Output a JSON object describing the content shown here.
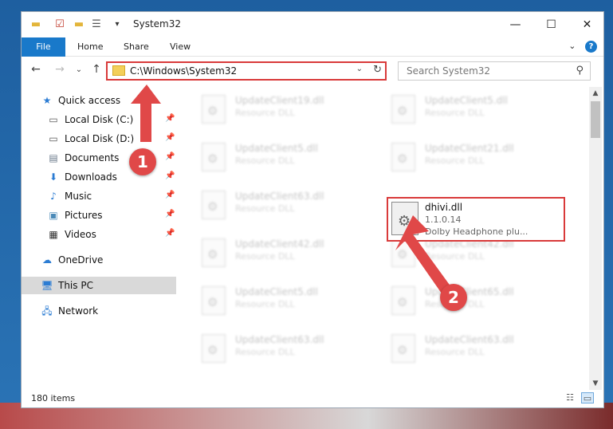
{
  "window": {
    "title": "System32",
    "controls": {
      "minimize": "—",
      "maximize": "☐",
      "close": "✕"
    }
  },
  "ribbon": {
    "tabs": [
      "File",
      "Home",
      "Share",
      "View"
    ],
    "expand": "⌄",
    "help": "?"
  },
  "address": {
    "path": "C:\\Windows\\System32",
    "search_placeholder": "Search System32"
  },
  "nav_pane": {
    "items": [
      {
        "label": "Quick access",
        "icon": "star-icon"
      },
      {
        "label": "Local Disk (C:)",
        "icon": "drive-icon"
      },
      {
        "label": "Local Disk (D:)",
        "icon": "drive-icon"
      },
      {
        "label": "Documents",
        "icon": "documents-icon"
      },
      {
        "label": "Downloads",
        "icon": "download-icon"
      },
      {
        "label": "Music",
        "icon": "music-icon"
      },
      {
        "label": "Pictures",
        "icon": "pictures-icon"
      },
      {
        "label": "Videos",
        "icon": "videos-icon"
      },
      {
        "label": "OneDrive",
        "icon": "cloud-icon"
      },
      {
        "label": "This PC",
        "icon": "computer-icon"
      },
      {
        "label": "Network",
        "icon": "network-icon"
      }
    ]
  },
  "files": [
    {
      "name": "UpdateClient19.dll",
      "desc": "Resource DLL"
    },
    {
      "name": "UpdateClient5.dll",
      "desc": "Resource DLL"
    },
    {
      "name": "UpdateClient5.dll",
      "desc": "Resource DLL"
    },
    {
      "name": "UpdateClient21.dll",
      "desc": "Resource DLL"
    },
    {
      "name": "UpdateClient63.dll",
      "desc": "Resource DLL"
    },
    {
      "name": "UpdateClient42.dll",
      "desc": "Resource DLL"
    },
    {
      "name": "UpdateClient42.dll",
      "desc": "Resource DLL"
    },
    {
      "name": "UpdateClient5.dll",
      "desc": "Resource DLL"
    },
    {
      "name": "UpdateClient65.dll",
      "desc": "Resource DLL"
    },
    {
      "name": "UpdateClient63.dll",
      "desc": "Resource DLL"
    },
    {
      "name": "UpdateClient63.dll",
      "desc": "Resource DLL"
    }
  ],
  "highlighted_file": {
    "name": "dhivi.dll",
    "version": "1.1.0.14",
    "description": "Dolby Headphone plu..."
  },
  "status": {
    "item_count": "180 items"
  },
  "annotations": {
    "badge1": "1",
    "badge2": "2",
    "color": "#e04848"
  }
}
